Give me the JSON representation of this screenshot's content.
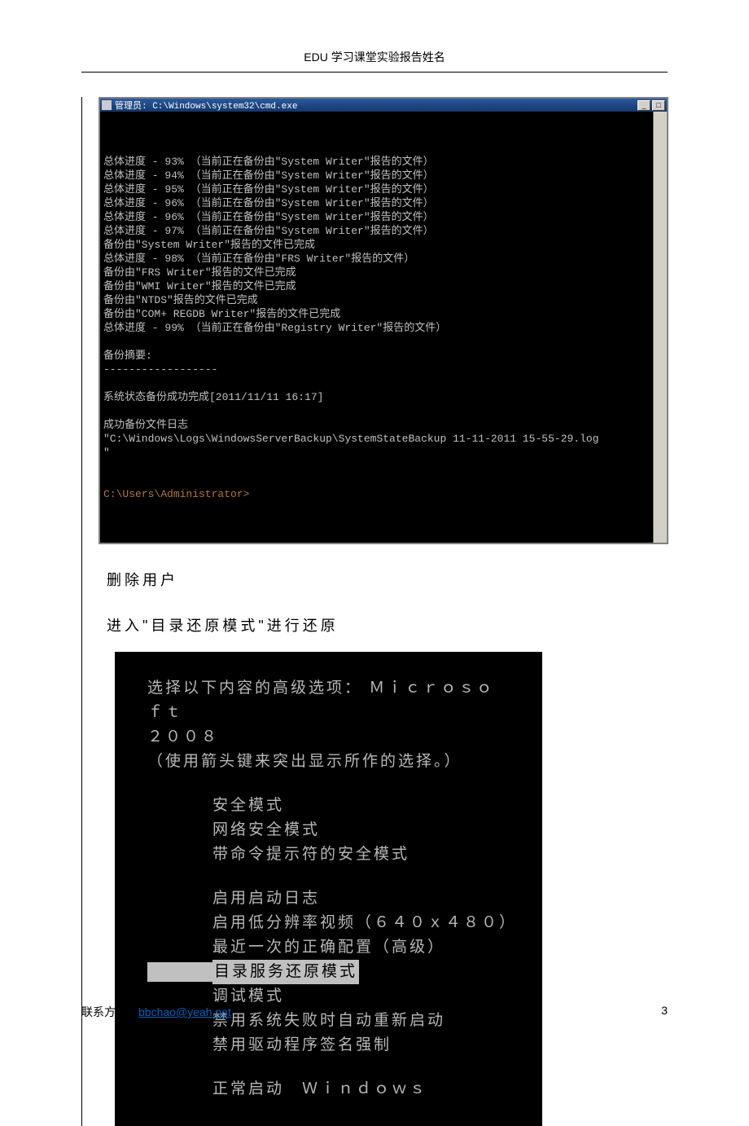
{
  "header": {
    "title": "EDU 学习课堂实验报告姓名"
  },
  "cmd": {
    "title": "管理员: C:\\Windows\\system32\\cmd.exe",
    "lines": [
      "总体进度 - 93% （当前正在备份由\"System Writer\"报告的文件）",
      "总体进度 - 94% （当前正在备份由\"System Writer\"报告的文件）",
      "总体进度 - 95% （当前正在备份由\"System Writer\"报告的文件）",
      "总体进度 - 96% （当前正在备份由\"System Writer\"报告的文件）",
      "总体进度 - 96% （当前正在备份由\"System Writer\"报告的文件）",
      "总体进度 - 97% （当前正在备份由\"System Writer\"报告的文件）",
      "备份由\"System Writer\"报告的文件已完成",
      "总体进度 - 98% （当前正在备份由\"FRS Writer\"报告的文件）",
      "备份由\"FRS Writer\"报告的文件已完成",
      "备份由\"WMI Writer\"报告的文件已完成",
      "备份由\"NTDS\"报告的文件已完成",
      "备份由\"COM+ REGDB Writer\"报告的文件已完成",
      "总体进度 - 99% （当前正在备份由\"Registry Writer\"报告的文件）",
      "",
      "备份摘要:",
      "------------------",
      "",
      "系统状态备份成功完成[2011/11/11 16:17]",
      "",
      "成功备份文件日志",
      "\"C:\\Windows\\Logs\\WindowsServerBackup\\SystemStateBackup 11-11-2011 15-55-29.log",
      "\"",
      "",
      ""
    ],
    "prompt": "C:\\Users\\Administrator>"
  },
  "body": {
    "line1": "删除用户",
    "line2": "进入\"目录还原模式\"进行还原"
  },
  "boot": {
    "header1": "选择以下内容的高级选项： Ｍｉｃｒｏｓｏｆｔ",
    "header2": "２００８",
    "header3": "（使用箭头键来突出显示所作的选择。）",
    "group1": [
      "安全模式",
      "网络安全模式",
      "带命令提示符的安全模式"
    ],
    "group2": [
      "启用启动日志",
      "启用低分辨率视频（６４０ｘ４８０）",
      "最近一次的正确配置（高级）"
    ],
    "selected": "目录服务还原模式",
    "group2b": [
      "调试模式",
      "禁用系统失败时自动重新启动",
      "禁用驱动程序签名强制"
    ],
    "group3": "正常启动　Ｗｉｎｄｏｗｓ"
  },
  "footer": {
    "contact_label": "联系方式：",
    "contact_email": "bbchao@yeah.net",
    "page_number": "3"
  }
}
